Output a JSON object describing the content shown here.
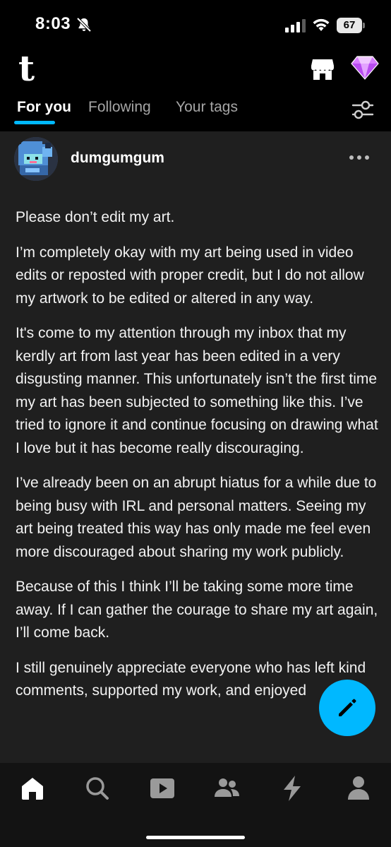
{
  "status_bar": {
    "time": "8:03",
    "battery": "67",
    "icons": [
      "bell-off-icon",
      "signal-icon",
      "wifi-icon",
      "battery-icon"
    ]
  },
  "header": {
    "logo": "t",
    "tabs": [
      {
        "label": "For you",
        "active": true
      },
      {
        "label": "Following",
        "active": false
      },
      {
        "label": "Your tags",
        "active": false
      }
    ],
    "icons": [
      "shop-icon",
      "gem-icon",
      "filter-icon"
    ]
  },
  "post": {
    "username": "dumgumgum",
    "paragraphs": [
      "Please don’t edit my art.",
      "I’m completely okay with my art being used in video edits or reposted with proper credit, but I do not allow my artwork to be edited or altered in any way.",
      "It's come to my attention through my inbox that my kerdly art from last year has been edited in a very disgusting manner. This unfortunately isn’t the first time my art has been subjected to something like this. I’ve tried to ignore it and continue focusing on drawing what I love but it has become really discouraging.",
      "I’ve already been on an abrupt hiatus for a while due to being busy with IRL and personal matters. Seeing my art being treated this way has only made me feel even more discouraged about sharing my work publicly.",
      "Because of this I think I’ll be taking some more time away. If I can gather the courage to share my art again, I’ll come back.",
      "I still genuinely appreciate everyone who has left kind comments, supported my work, and enjoyed"
    ]
  },
  "bottom_nav": {
    "items": [
      "home-icon",
      "search-icon",
      "video-icon",
      "communities-icon",
      "activity-icon",
      "account-icon"
    ]
  },
  "colors": {
    "accent": "#00b8ff",
    "post_bg": "#1f1f1f",
    "background": "#000000",
    "nav_bg": "#131313"
  }
}
